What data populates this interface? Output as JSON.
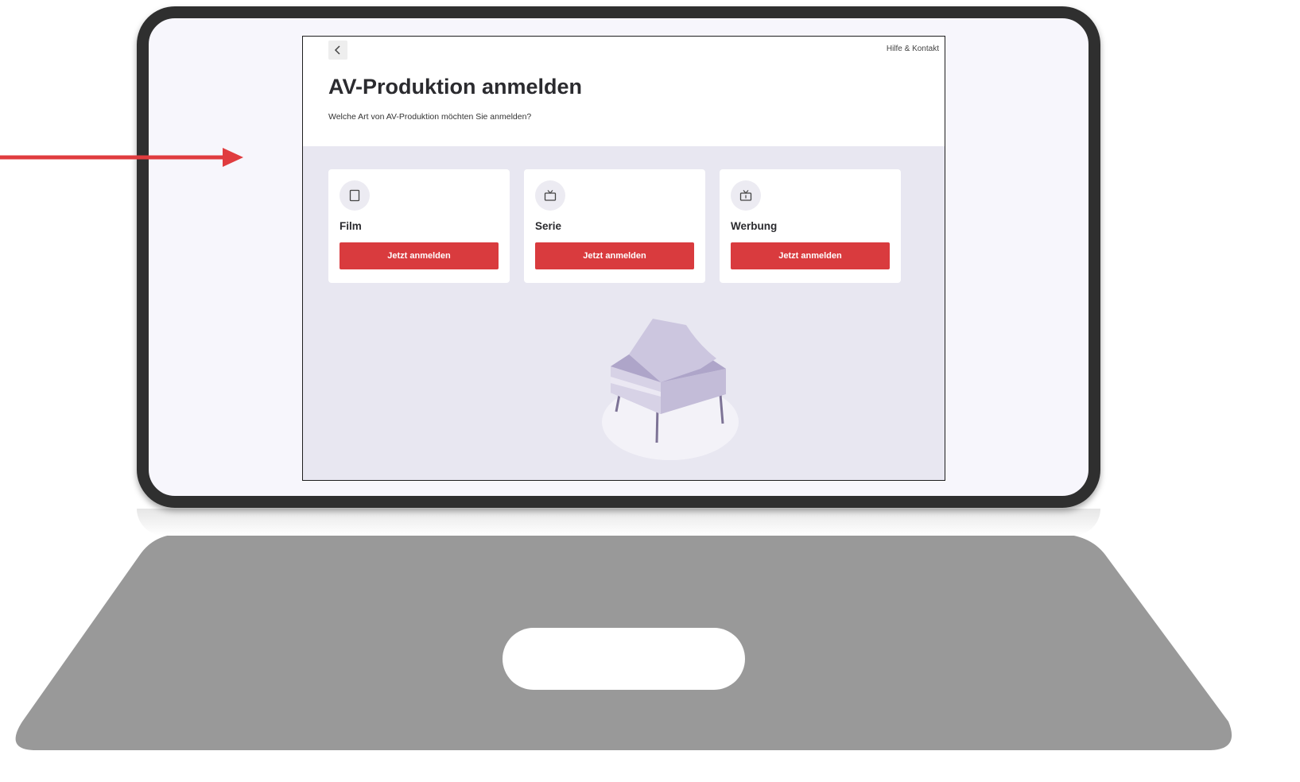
{
  "screen": {
    "back_icon": "chevron-left-icon",
    "help_link": "Hilfe & Kontakt",
    "title": "AV-Produktion anmelden",
    "subtitle": "Welche Art von AV-Produktion möchten Sie anmelden?",
    "cards": [
      {
        "label": "Film",
        "icon": "tablet-icon",
        "button_label": "Jetzt anmelden"
      },
      {
        "label": "Serie",
        "icon": "tv-icon",
        "button_label": "Jetzt anmelden"
      },
      {
        "label": "Werbung",
        "icon": "tv-ad-icon",
        "button_label": "Jetzt anmelden"
      }
    ],
    "illustration": "grand-piano-illustration"
  },
  "colors": {
    "accent_red": "#d93b3e",
    "arrow_red": "#e03c3f",
    "content_background": "#e8e7f1",
    "laptop_frame": "#2f2f2f",
    "laptop_base": "#999999"
  }
}
